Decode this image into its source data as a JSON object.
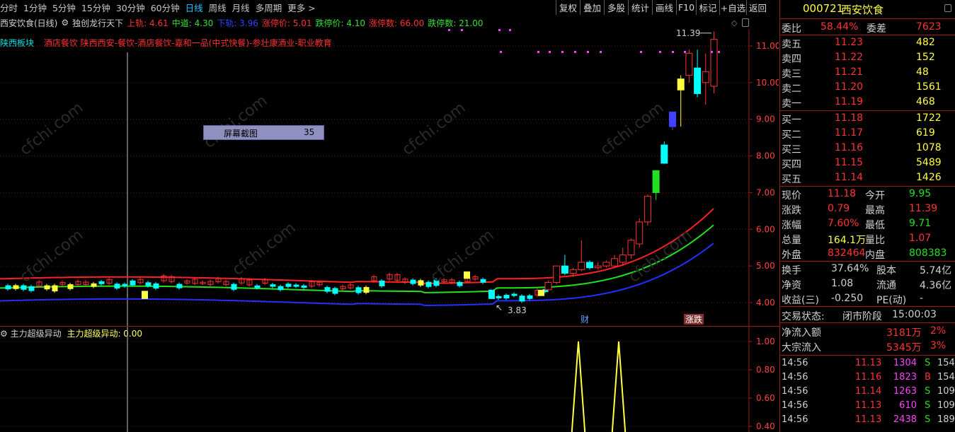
{
  "periods": [
    "分时",
    "1分钟",
    "5分钟",
    "15分钟",
    "30分钟",
    "60分钟",
    "日线",
    "周线",
    "月线",
    "多周期",
    "更多 >"
  ],
  "active_period": "日线",
  "toolbar": [
    "复权",
    "叠加",
    "多股",
    "统计",
    "画线",
    "F10",
    "标记",
    "+自选",
    "返回"
  ],
  "header": {
    "stock_title": "西安饮食(日线)",
    "indicator_name": "独创龙行天下",
    "upper_label": "上轨: 4.61",
    "mid_label": "中道: 4.30",
    "lower_label": "下轨: 3.96",
    "limit_up_price": "涨停价: 5.01",
    "limit_down_price": "跌停价: 4.10",
    "limit_up_count": "涨停数: 66.00",
    "limit_down_count": "跌停数: 21.00"
  },
  "sector_line": {
    "prefix": "陕西板块",
    "tags": "酒店餐饮   陕西西安-餐饮-酒店餐饮-嘉和一品(中式快餐)-参壮康酒业-职业教育"
  },
  "screenshot_popup": {
    "label": "屏幕截图",
    "value": "35"
  },
  "chart_data": [
    {
      "type": "candlestick",
      "title": "西安饮食(日线)",
      "ylim": [
        3.7,
        11.7
      ],
      "y_ticks": [
        "11.00",
        "10.00",
        "9.00",
        "8.00",
        "7.00",
        "6.00",
        "5.00",
        "4.00"
      ],
      "annotations": {
        "high": "11.39",
        "low": "3.83"
      },
      "event_markers": [
        "财",
        "涨跌"
      ],
      "bands": [
        {
          "name": "上轨",
          "color": "#ff2020"
        },
        {
          "name": "中道",
          "color": "#20e020"
        },
        {
          "name": "下轨",
          "color": "#2030ff"
        }
      ],
      "candles_recent": [
        {
          "o": 4.35,
          "c": 4.55,
          "h": 4.6,
          "l": 4.3
        },
        {
          "o": 4.55,
          "c": 5.0,
          "h": 5.0,
          "l": 4.5
        },
        {
          "o": 5.0,
          "c": 4.8,
          "h": 5.3,
          "l": 4.75
        },
        {
          "o": 4.8,
          "c": 4.9,
          "h": 4.95,
          "l": 4.7
        },
        {
          "o": 4.9,
          "c": 5.1,
          "h": 5.7,
          "l": 4.85
        },
        {
          "o": 5.1,
          "c": 4.95,
          "h": 5.15,
          "l": 4.9
        },
        {
          "o": 4.95,
          "c": 5.0,
          "h": 5.1,
          "l": 4.9
        },
        {
          "o": 5.0,
          "c": 5.1,
          "h": 5.15,
          "l": 4.95
        },
        {
          "o": 5.0,
          "c": 5.2,
          "h": 5.3,
          "l": 4.95
        },
        {
          "o": 5.1,
          "c": 5.3,
          "h": 5.5,
          "l": 5.0
        },
        {
          "o": 5.3,
          "c": 5.7,
          "h": 5.75,
          "l": 5.2
        },
        {
          "o": 5.6,
          "c": 6.2,
          "h": 6.3,
          "l": 5.5
        },
        {
          "o": 6.2,
          "c": 6.9,
          "h": 6.95,
          "l": 6.1
        },
        {
          "o": 7.0,
          "c": 7.6,
          "h": 7.6,
          "l": 6.8
        },
        {
          "o": 8.3,
          "c": 7.8,
          "h": 8.4,
          "l": 7.8
        },
        {
          "o": 9.2,
          "c": 8.8,
          "h": 9.2,
          "l": 8.7
        },
        {
          "o": 10.1,
          "c": 9.8,
          "h": 10.2,
          "l": 8.8
        },
        {
          "o": 10.2,
          "c": 10.8,
          "h": 10.9,
          "l": 10.0
        },
        {
          "o": 10.4,
          "c": 9.7,
          "h": 10.9,
          "l": 9.6
        },
        {
          "o": 10.0,
          "c": 10.3,
          "h": 10.8,
          "l": 9.4
        },
        {
          "o": 9.9,
          "c": 11.18,
          "h": 11.39,
          "l": 9.71
        }
      ]
    },
    {
      "type": "line",
      "title": "主力超级异动",
      "legend": "主力超级异动: 0.00",
      "ylim": [
        0.4,
        1.1
      ],
      "y_ticks": [
        "1.00",
        "0.80",
        "0.60",
        "0.40"
      ],
      "peaks_at": [
        "pre-breakout",
        "breakout"
      ]
    }
  ],
  "subchart_title": "主力超级异动",
  "subchart_value_label": "主力超级异动: 0.00",
  "right_panel": {
    "code": "000721",
    "name": "西安饮食",
    "webi_label": "委比",
    "webi_value": "58.44%",
    "weicha_label": "委差",
    "weicha_value": "7623",
    "asks": [
      {
        "label": "卖五",
        "price": "11.23",
        "vol": "482"
      },
      {
        "label": "卖四",
        "price": "11.22",
        "vol": "152"
      },
      {
        "label": "卖三",
        "price": "11.21",
        "vol": "48"
      },
      {
        "label": "卖二",
        "price": "11.20",
        "vol": "1561"
      },
      {
        "label": "卖一",
        "price": "11.19",
        "vol": "468"
      }
    ],
    "bids": [
      {
        "label": "买一",
        "price": "11.18",
        "vol": "1722"
      },
      {
        "label": "买二",
        "price": "11.17",
        "vol": "619"
      },
      {
        "label": "买三",
        "price": "11.16",
        "vol": "1078"
      },
      {
        "label": "买四",
        "price": "11.15",
        "vol": "5489"
      },
      {
        "label": "买五",
        "price": "11.14",
        "vol": "1426"
      }
    ],
    "stats": [
      {
        "l1": "现价",
        "v1": "11.18",
        "l2": "今开",
        "v2": "9.95"
      },
      {
        "l1": "涨跌",
        "v1": "0.79",
        "l2": "最高",
        "v2": "11.39"
      },
      {
        "l1": "涨幅",
        "v1": "7.60%",
        "l2": "最低",
        "v2": "9.71"
      },
      {
        "l1": "总量",
        "v1": "164.1万",
        "l2": "量比",
        "v2": "1.07"
      },
      {
        "l1": "外盘",
        "v1": "832464",
        "l2": "内盘",
        "v2": "808383"
      }
    ],
    "fundamentals": [
      {
        "l1": "换手",
        "v1": "37.64%",
        "l2": "股本",
        "v2": "5.74亿"
      },
      {
        "l1": "净资",
        "v1": "1.08",
        "l2": "流通",
        "v2": "4.36亿"
      },
      {
        "l1": "收益(三)",
        "v1": "-0.250",
        "l2": "PE(动)",
        "v2": "-"
      }
    ],
    "status_label": "交易状态:",
    "status_value": "闭市阶段",
    "status_time": "15:00:03",
    "netflow_label": "净流入额",
    "netflow_value": "3181万",
    "netflow_pct": "2%",
    "block_label": "大宗流入",
    "block_value": "5345万",
    "block_pct": "3%",
    "trades": [
      {
        "time": "14:56",
        "price": "11.13",
        "vol": "1304",
        "side": "S",
        "n": "154"
      },
      {
        "time": "14:56",
        "price": "11.16",
        "vol": "1823",
        "side": "B",
        "n": "154"
      },
      {
        "time": "14:56",
        "price": "11.14",
        "vol": "1263",
        "side": "S",
        "n": "109"
      },
      {
        "time": "14:56",
        "price": "11.13",
        "vol": "610",
        "side": "S",
        "n": "109"
      },
      {
        "time": "14:56",
        "price": "11.13",
        "vol": "2438",
        "side": "S",
        "n": "189"
      }
    ]
  },
  "colors": {
    "up": "#ff3232",
    "down": "#00ffff",
    "neutral": "#d0d0d0",
    "accent": "#ffff00",
    "border": "#9a1a1a"
  }
}
